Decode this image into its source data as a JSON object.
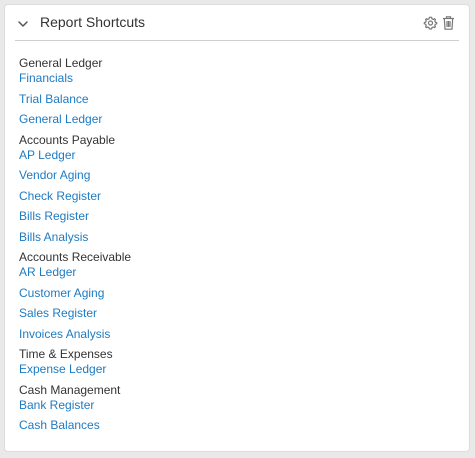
{
  "widget": {
    "title": "Report Shortcuts",
    "icons": {
      "toggle": "chevron-down-icon",
      "settings": "gear-icon",
      "delete": "trash-icon"
    },
    "colors": {
      "link": "#1e7bc2",
      "heading": "#333333"
    }
  },
  "groups": [
    {
      "title": "General Ledger",
      "links": [
        "Financials",
        "Trial Balance",
        "General Ledger"
      ]
    },
    {
      "title": "Accounts Payable",
      "links": [
        "AP Ledger",
        "Vendor Aging",
        "Check Register",
        "Bills Register",
        "Bills Analysis"
      ]
    },
    {
      "title": "Accounts Receivable",
      "links": [
        "AR Ledger",
        "Customer Aging",
        "Sales Register",
        "Invoices Analysis"
      ]
    },
    {
      "title": "Time & Expenses",
      "links": [
        "Expense Ledger"
      ]
    },
    {
      "title": "Cash Management",
      "links": [
        "Bank Register",
        "Cash Balances"
      ]
    }
  ]
}
